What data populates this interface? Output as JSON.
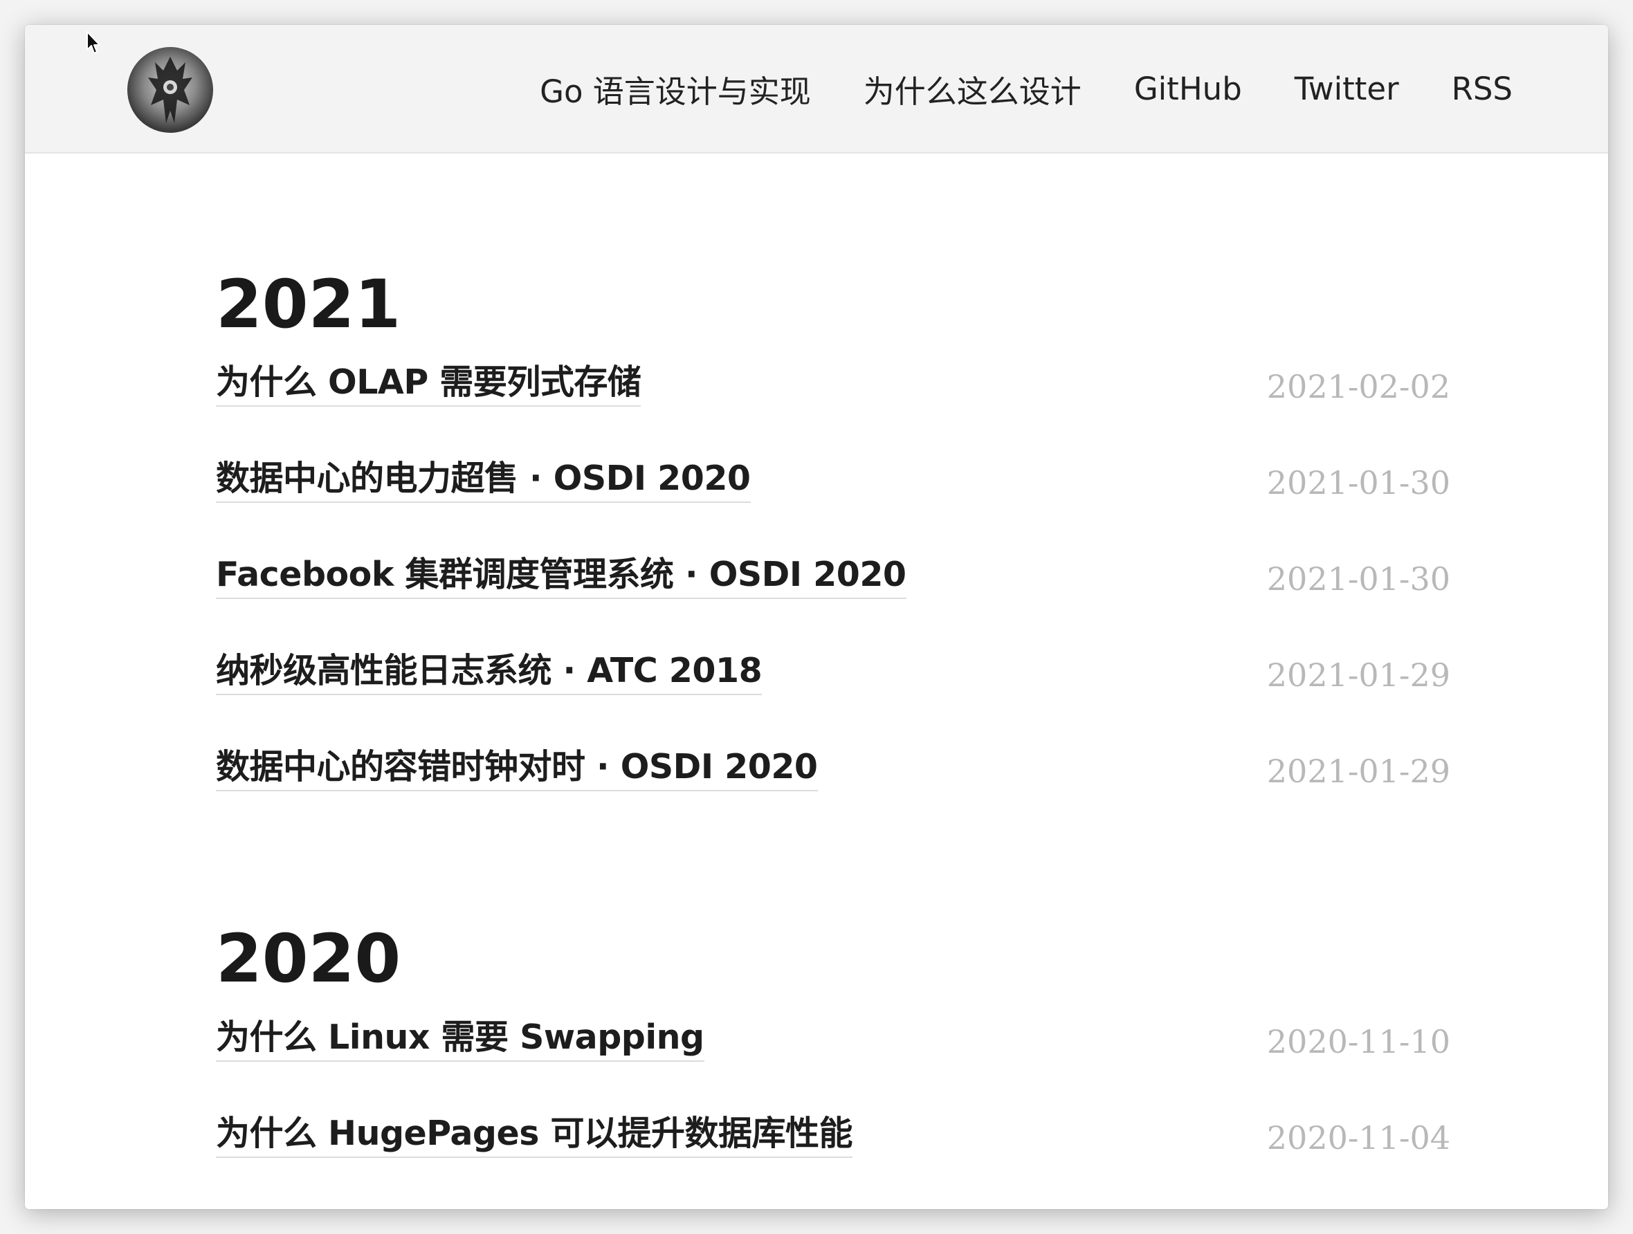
{
  "header": {
    "avatar_alt": "avatar",
    "nav": [
      {
        "label": "Go 语言设计与实现"
      },
      {
        "label": "为什么这么设计"
      },
      {
        "label": "GitHub"
      },
      {
        "label": "Twitter"
      },
      {
        "label": "RSS"
      }
    ]
  },
  "archive": {
    "years": [
      {
        "year": "2021",
        "posts": [
          {
            "title": "为什么 OLAP 需要列式存储",
            "date": "2021-02-02"
          },
          {
            "title": "数据中心的电力超售 · OSDI 2020",
            "date": "2021-01-30"
          },
          {
            "title": "Facebook 集群调度管理系统 · OSDI 2020",
            "date": "2021-01-30"
          },
          {
            "title": "纳秒级高性能日志系统 · ATC 2018",
            "date": "2021-01-29"
          },
          {
            "title": "数据中心的容错时钟对时 · OSDI 2020",
            "date": "2021-01-29"
          }
        ]
      },
      {
        "year": "2020",
        "posts": [
          {
            "title": "为什么 Linux 需要 Swapping",
            "date": "2020-11-10"
          },
          {
            "title": "为什么 HugePages 可以提升数据库性能",
            "date": "2020-11-04"
          }
        ]
      }
    ]
  }
}
